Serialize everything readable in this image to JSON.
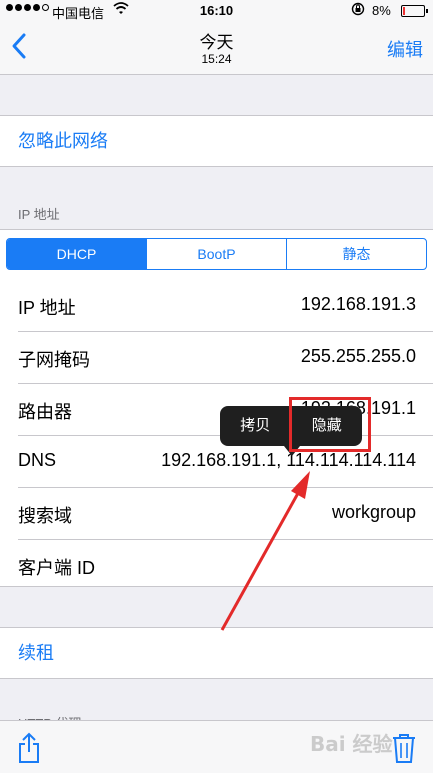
{
  "status_bar": {
    "carrier": "中国电信",
    "time": "16:10",
    "battery_pct": "8%",
    "battery_level": 0.08,
    "signal_bars_filled": 4,
    "signal_bars_total": 5
  },
  "nav": {
    "title": "今天",
    "subtitle": "15:24",
    "edit_label": "编辑"
  },
  "forget_network_label": "忽略此网络",
  "ip_section": {
    "header": "IP 地址",
    "tabs": [
      {
        "label": "DHCP",
        "active": true
      },
      {
        "label": "BootP",
        "active": false
      },
      {
        "label": "静态",
        "active": false
      }
    ],
    "rows": [
      {
        "label": "IP 地址",
        "value": "192.168.191.3"
      },
      {
        "label": "子网掩码",
        "value": "255.255.255.0"
      },
      {
        "label": "路由器",
        "value": "192.168.191.1"
      },
      {
        "label": "DNS",
        "value": "192.168.191.1, 114.114.114.114"
      },
      {
        "label": "搜索域",
        "value": "workgroup"
      },
      {
        "label": "客户端 ID",
        "value": ""
      }
    ]
  },
  "context_menu": {
    "copy_label": "拷贝",
    "hide_label": "隐藏"
  },
  "renew_lease_label": "续租",
  "next_section_header": "HTTP 代理",
  "watermark_text": "Bai 经验",
  "colors": {
    "accent": "#1a7cf5",
    "annotation_red": "#e32a2a",
    "menu_bg": "#1f1f1f"
  }
}
